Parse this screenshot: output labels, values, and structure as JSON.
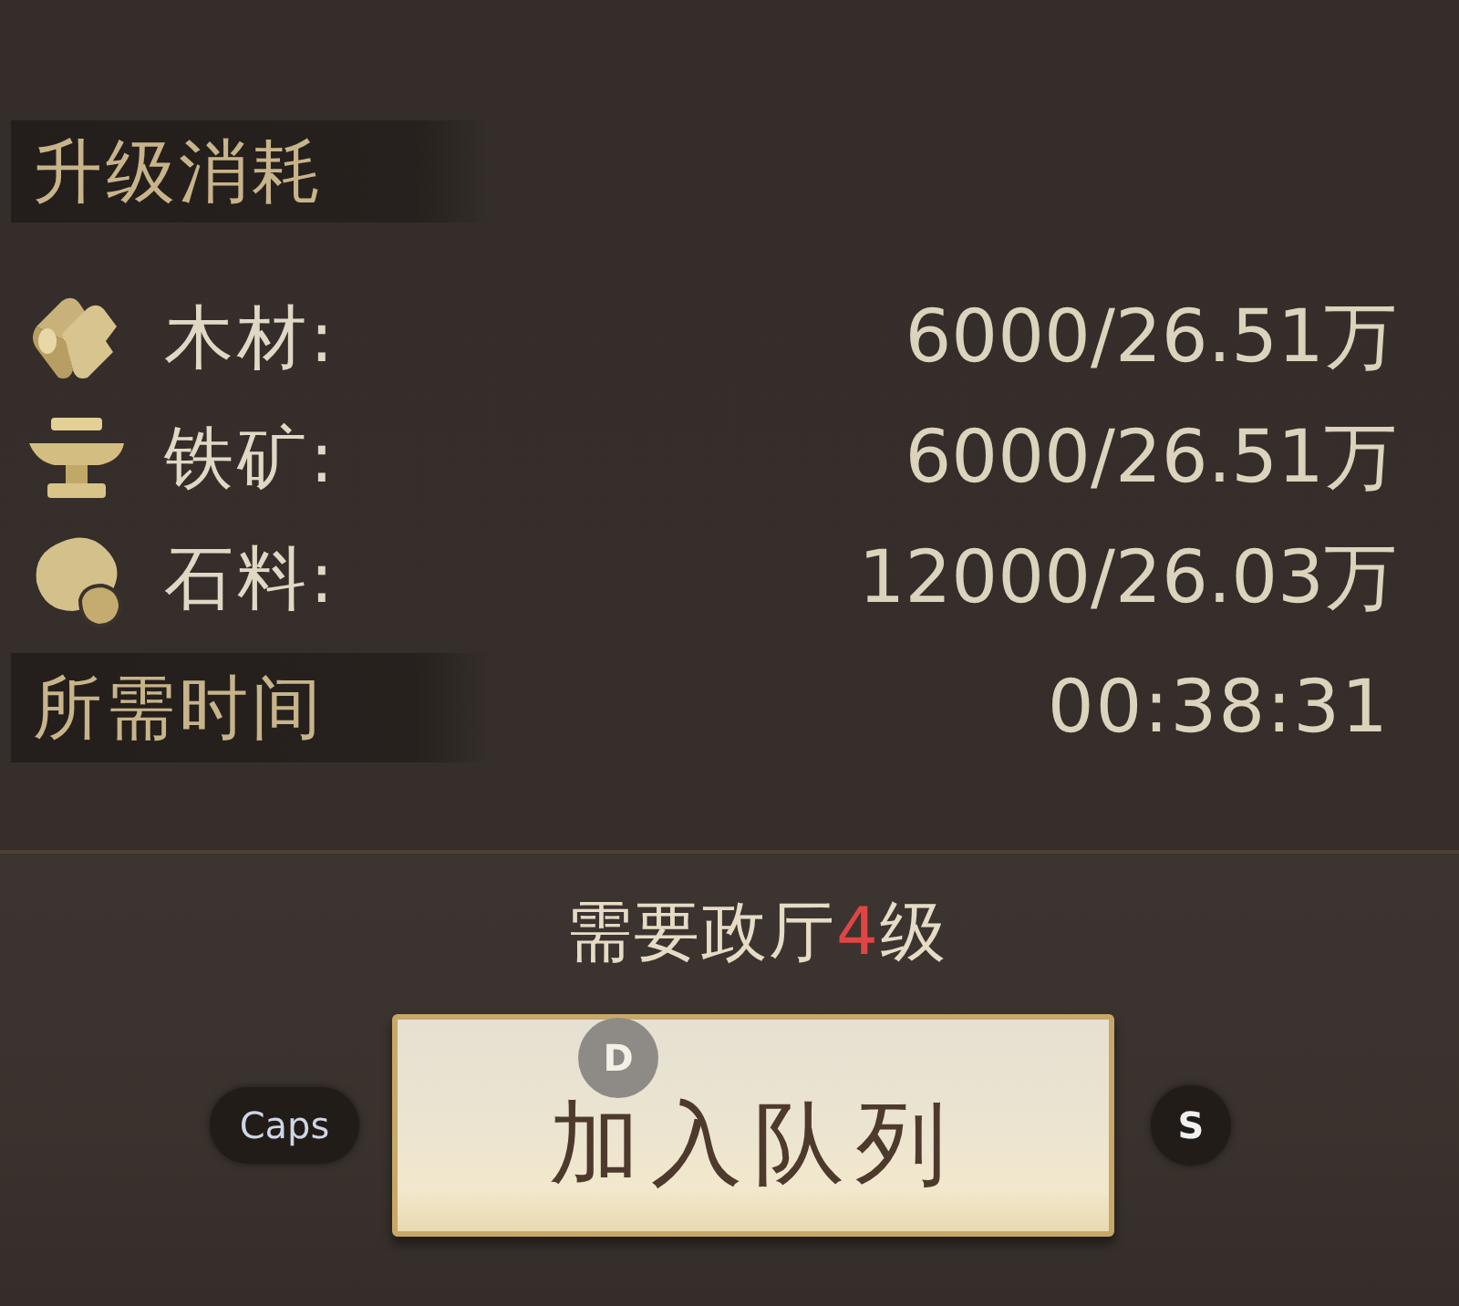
{
  "cost_section": {
    "title": "升级消耗",
    "resources": [
      {
        "kind": "wood",
        "label": "木材:",
        "amount": "6000/26.51万"
      },
      {
        "kind": "iron",
        "label": "铁矿:",
        "amount": "6000/26.51万"
      },
      {
        "kind": "stone",
        "label": "石料:",
        "amount": "12000/26.03万"
      }
    ]
  },
  "time_section": {
    "title": "所需时间",
    "value": "00:38:31"
  },
  "requirement": {
    "prefix": "需要政厅",
    "level": "4",
    "suffix": "级"
  },
  "action_row": {
    "left_key": "Caps",
    "button": "加入队列",
    "button_key": "D",
    "right_key": "S"
  }
}
